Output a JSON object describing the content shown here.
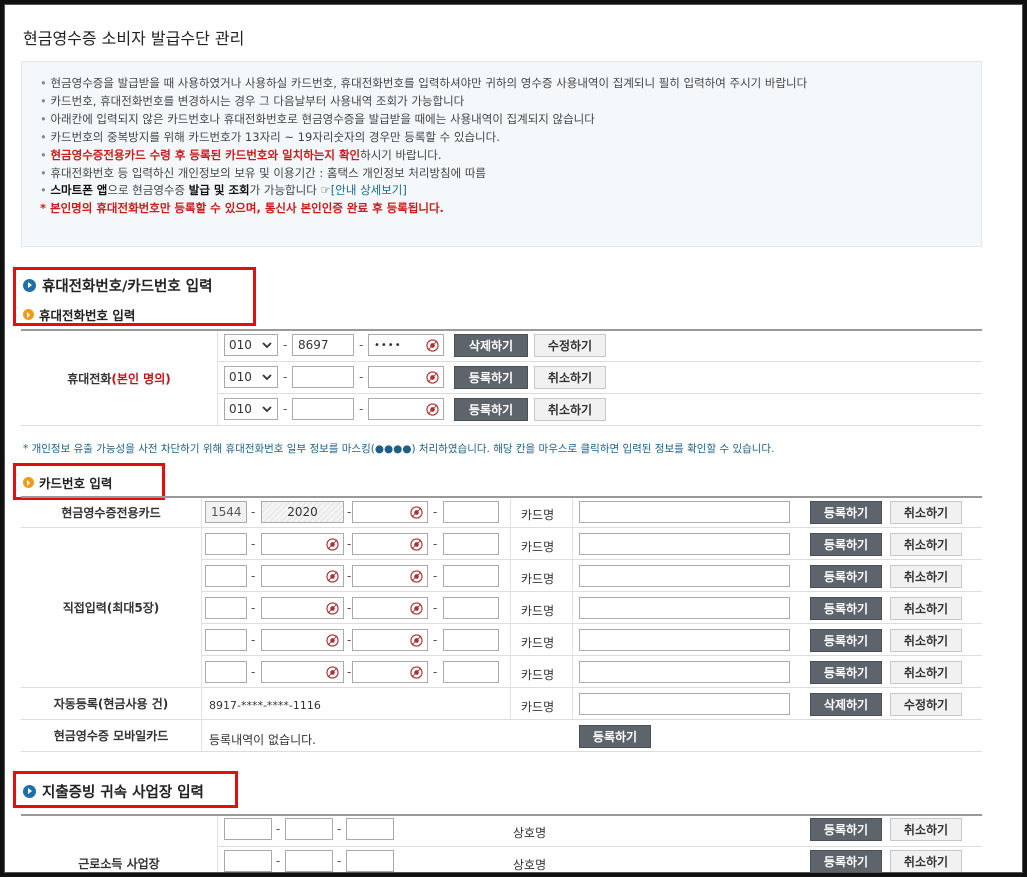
{
  "page_title": "현금영수증 소비자 발급수단 관리",
  "notice": {
    "line1": "현금영수증을 발급받을 때 사용하였거나 사용하실 카드번호, 휴대전화번호를 입력하셔야만 귀하의 영수증 사용내역이 집계되니 필히 입력하여 주시기 바랍니다",
    "line2": "카드번호, 휴대전화번호를 변경하시는 경우 그 다음날부터 사용내역 조회가 가능합니다",
    "line3": "아래칸에 입력되지 않은 카드번호나 휴대전화번호로 현금영수증을 발급받을 때에는 사용내역이 집계되지 않습니다",
    "line4": "카드번호의 중복방지를 위해 카드번호가 13자리 ~ 19자리숫자의 경우만 등록할 수 있습니다.",
    "line5_red": "현금영수증전용카드 수령 후 등록된 카드번호와 일치하는지 확인",
    "line5_rest": "하시기 바랍니다.",
    "line6": "휴대전화번호 등 입력하신 개인정보의 보유 및 이용기간 : 홈택스 개인정보 처리방침에 따름",
    "line7_b1": "스마트폰 앱",
    "line7_t1": "으로 현금영수증 ",
    "line7_b2": "발급 및 조회",
    "line7_t2": "가 가능합니다 ",
    "line7_link": "[안내 상세보기]",
    "line8": "* 본인명의 휴대전화번호만 등록할 수 있으며, 통신사 본인인증 완료 후 등록됩니다."
  },
  "section1": {
    "title": "휴대전화번호/카드번호 입력",
    "sub": "휴대전화번호 입력",
    "label_main": "휴대전화",
    "label_red": "(본인 명의)",
    "rows": [
      {
        "prefix": "010",
        "mid": "8697",
        "last": "••••",
        "btn1": "삭제하기",
        "btn2": "수정하기"
      },
      {
        "prefix": "010",
        "mid": "",
        "last": "",
        "btn1": "등록하기",
        "btn2": "취소하기"
      },
      {
        "prefix": "010",
        "mid": "",
        "last": "",
        "btn1": "등록하기",
        "btn2": "취소하기"
      }
    ],
    "privacy_note": "* 개인정보 유출 가능성을 사전 차단하기 위해 휴대전화번호 일부 정보를 마스킹(●●●●) 처리하였습니다. 해당 칸을 마우스로 클릭하면 입력된 정보를 확인할 수 있습니다."
  },
  "section_card": {
    "sub": "카드번호 입력",
    "card_name_label": "카드명",
    "dedicated": {
      "label": "현금영수증전용카드",
      "p1": "1544",
      "p2": "2020",
      "btn1": "등록하기",
      "btn2": "취소하기"
    },
    "direct_label": "직접입력(최대5장)",
    "direct_btn1": "등록하기",
    "direct_btn2": "취소하기",
    "auto": {
      "label": "자동등록(현금사용 건)",
      "number": "8917-****-****-1116",
      "btn1": "삭제하기",
      "btn2": "수정하기"
    },
    "mobile": {
      "label": "현금영수증 모바일카드",
      "text": "등록내역이 없습니다.",
      "btn": "등록하기"
    }
  },
  "section3": {
    "title": "지출증빙 귀속 사업장 입력",
    "name_label": "상호명",
    "row_label": "근로소득 사업장",
    "btn1": "등록하기",
    "btn2": "취소하기"
  }
}
